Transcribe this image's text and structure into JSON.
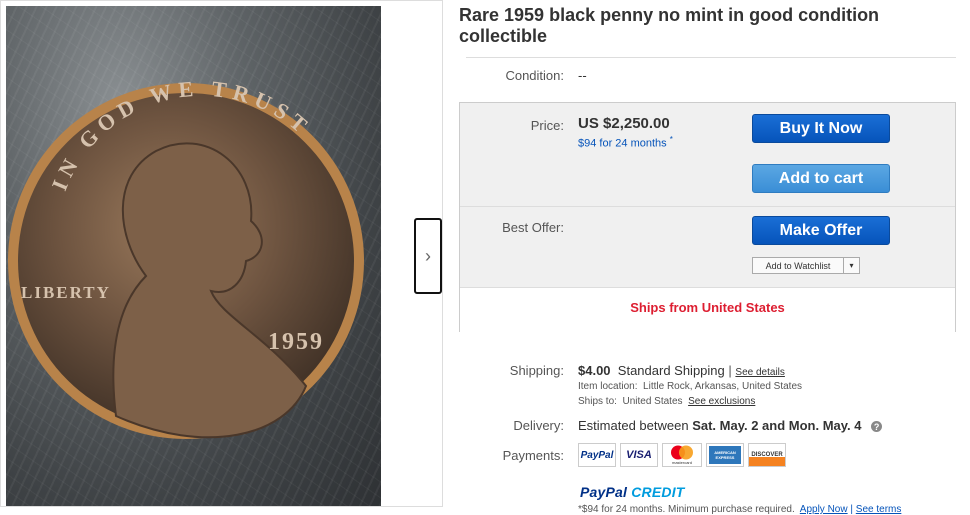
{
  "listing": {
    "title": "Rare 1959 black penny no mint in good condition collectible"
  },
  "image": {
    "coin_text_top": "IN GOD WE TRUST",
    "coin_text_left": "LIBERTY",
    "coin_year": "1959",
    "next_arrow": "›"
  },
  "condition": {
    "label": "Condition:",
    "value": "--"
  },
  "price": {
    "label": "Price:",
    "value": "US $2,250.00",
    "monthly": "$94 for 24 months",
    "monthly_mark": "*"
  },
  "buttons": {
    "buy_now": "Buy It Now",
    "add_to_cart": "Add to cart",
    "make_offer": "Make Offer",
    "watchlist": "Add to Watchlist",
    "watchlist_caret": "▾"
  },
  "best_offer": {
    "label": "Best Offer:"
  },
  "ships_from": "Ships from United States",
  "shipping": {
    "label": "Shipping:",
    "cost": "$4.00",
    "method": "Standard Shipping",
    "separator": "|",
    "details_link": "See details",
    "item_location_label": "Item location:",
    "item_location": "Little Rock, Arkansas, United States",
    "ships_to_label": "Ships to:",
    "ships_to": "United States",
    "exclusions_link": "See exclusions"
  },
  "delivery": {
    "label": "Delivery:",
    "prefix": "Estimated between",
    "dates": "Sat. May. 2 and Mon. May. 4",
    "info": "?"
  },
  "payments": {
    "label": "Payments:",
    "paypal": "PayPal",
    "visa": "VISA",
    "mastercard": "mastercard",
    "amex": "AMERICAN EXPRESS",
    "discover": "DISCOVER"
  },
  "paypal_credit": {
    "paypal": "PayPal",
    "credit": "CREDIT",
    "note": "*$94 for 24 months. Minimum purchase required.",
    "apply_link": "Apply Now",
    "separator": "|",
    "terms_link": "See terms"
  },
  "colors": {
    "primary_button": "#0654ba",
    "secondary_button": "#3a8ed6",
    "ships_red": "#dd1e31",
    "link_blue": "#0654ba"
  }
}
